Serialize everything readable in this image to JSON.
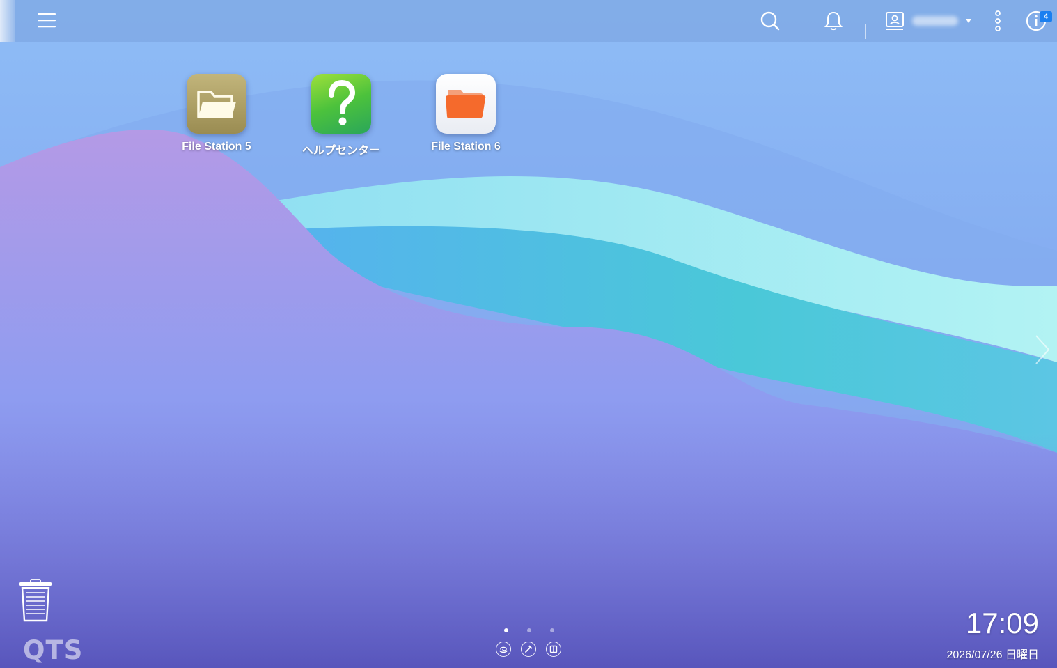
{
  "topbar": {
    "menu_icon": "hamburger-menu-icon",
    "search_icon": "search-icon",
    "notification_icon": "bell-icon",
    "user_icon": "user-account-icon",
    "user_name": "",
    "more_icon": "vertical-dots-icon",
    "info_icon": "info-icon",
    "info_badge": "4"
  },
  "desktop_apps": [
    {
      "label": "File Station 5",
      "icon": "folder-icon"
    },
    {
      "label": "ヘルプセンター",
      "icon": "question-mark-icon"
    },
    {
      "label": "File Station 6",
      "icon": "orange-folder-icon"
    }
  ],
  "trash": {
    "icon": "trash-icon"
  },
  "logo": {
    "text": "QTS"
  },
  "pager": {
    "pages": 3,
    "active_page": 1
  },
  "bottom_buttons": [
    {
      "icon": "swirl-icon"
    },
    {
      "icon": "tools-icon"
    },
    {
      "icon": "book-icon"
    }
  ],
  "clock": {
    "time": "17:09",
    "date": "2026/07/26 日曜日"
  },
  "colors": {
    "topbar": "#7aa4dc",
    "badge": "#1a7ff0",
    "wave_purple": "#a88fe6",
    "wave_teal": "#5fd0e0",
    "wave_mint": "#a8f0f2"
  }
}
